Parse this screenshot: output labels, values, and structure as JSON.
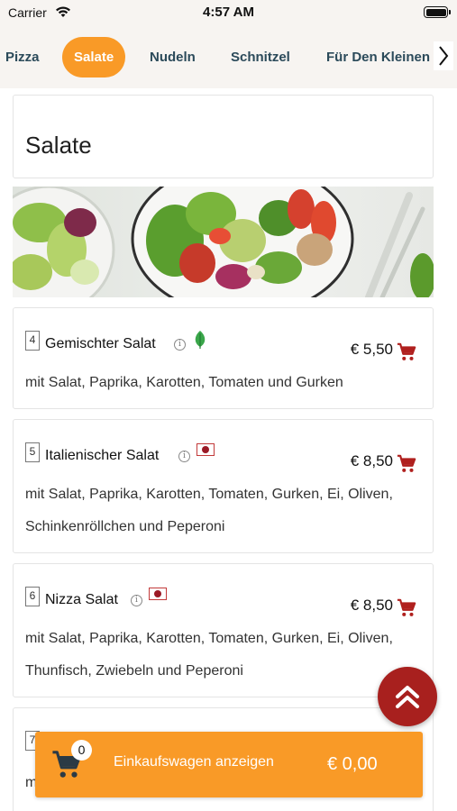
{
  "status_bar": {
    "carrier": "Carrier",
    "time": "4:57 AM"
  },
  "categories": {
    "tabs": [
      {
        "label": "Pizza",
        "active": false
      },
      {
        "label": "Salate",
        "active": true
      },
      {
        "label": "Nudeln",
        "active": false
      },
      {
        "label": "Schnitzel",
        "active": false
      },
      {
        "label": "Für Den Kleinen",
        "active": false
      }
    ]
  },
  "section": {
    "title": "Salate"
  },
  "items": [
    {
      "number": "4",
      "name": "Gemischter Salat",
      "badge": "leaf-icon",
      "price": "€ 5,50",
      "description": "mit Salat, Paprika, Karotten, Tomaten und Gurken"
    },
    {
      "number": "5",
      "name": "Italienischer Salat",
      "badge": "flag-icon",
      "price": "€ 8,50",
      "description": "mit Salat, Paprika, Karotten, Tomaten, Gurken, Ei, Oliven, Schinkenröllchen und Peperoni"
    },
    {
      "number": "6",
      "name": "Nizza Salat",
      "badge": "flag-icon",
      "price": "€ 8,50",
      "description": "mit Salat, Paprika, Karotten, Tomaten, Gurken, Ei, Oliven, Thunfisch, Zwiebeln und Peperoni"
    },
    {
      "number": "7",
      "name": "",
      "price": "",
      "description": "m"
    }
  ],
  "cart": {
    "count": "0",
    "label": "Einkaufswagen anzeigen",
    "total": "€ 0,00"
  },
  "colors": {
    "accent": "#f99a27",
    "tab_text": "#2b4a5a",
    "cart_red": "#a8201e",
    "status_bg": "#f7f4f1"
  }
}
